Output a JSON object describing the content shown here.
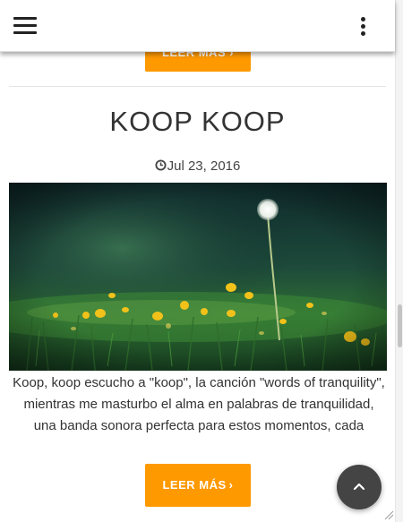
{
  "appbar": {
    "menu_icon": "hamburger-menu-icon",
    "more_icon": "vertical-dots-icon"
  },
  "previous_post": {
    "button_label": "LEER MÁS ›"
  },
  "post": {
    "title": "KOOP KOOP",
    "date": "Jul 23, 2016",
    "date_icon": "clock-icon",
    "image_subject": "dandelion-meadow-photo",
    "excerpt": "Koop, koop escucho a \"koop\", la canción \"words of tranquility\", mientras me masturbo el alma en palabras de tranquilidad, una banda sonora perfecta para estos momentos, cada",
    "read_more_label": "LEER MÁS",
    "read_more_chevron": "›"
  },
  "back_to_top": {
    "icon": "chevron-up-icon"
  },
  "colors": {
    "accent": "#ff9900",
    "appbar_bg": "#ffffff",
    "fab_bg": "#444444",
    "text": "#333333"
  }
}
